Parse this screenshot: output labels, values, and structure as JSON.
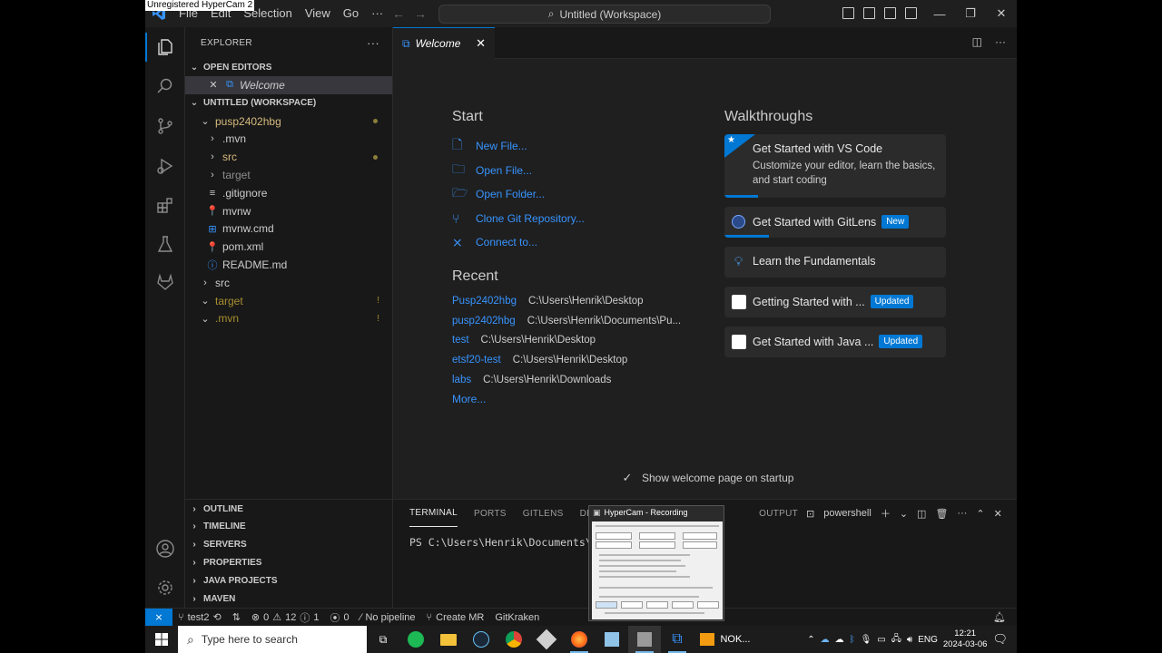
{
  "recorder_label": "Unregistered HyperCam 2",
  "menu": [
    "File",
    "Edit",
    "Selection",
    "View",
    "Go",
    "···"
  ],
  "command_center": "Untitled (Workspace)",
  "explorer": {
    "title": "EXPLORER",
    "open_editors": "OPEN EDITORS",
    "open_file": "Welcome",
    "workspace": "UNTITLED (WORKSPACE)",
    "tree": [
      {
        "label": "pusp2402hbg",
        "indent": 1,
        "chev": "⌄",
        "color": "#d7ba7d",
        "mark": "dot"
      },
      {
        "label": ".mvn",
        "indent": 2,
        "chev": "›",
        "color": "#cccccc",
        "mark": ""
      },
      {
        "label": "src",
        "indent": 2,
        "chev": "›",
        "color": "#d7ba7d",
        "mark": "dot"
      },
      {
        "label": "target",
        "indent": 2,
        "chev": "›",
        "color": "#8c8c8c",
        "mark": ""
      },
      {
        "label": ".gitignore",
        "indent": 2,
        "chev": "",
        "icon": "≡",
        "iconColor": "#cccccc",
        "color": "#cccccc",
        "mark": ""
      },
      {
        "label": "mvnw",
        "indent": 2,
        "chev": "",
        "icon": "📍",
        "iconColor": "#e44",
        "color": "#cccccc",
        "mark": ""
      },
      {
        "label": "mvnw.cmd",
        "indent": 2,
        "chev": "",
        "icon": "⊞",
        "iconColor": "#3794ff",
        "color": "#cccccc",
        "mark": ""
      },
      {
        "label": "pom.xml",
        "indent": 2,
        "chev": "",
        "icon": "📍",
        "iconColor": "#e44",
        "color": "#cccccc",
        "mark": ""
      },
      {
        "label": "README.md",
        "indent": 2,
        "chev": "",
        "icon": "ⓘ",
        "iconColor": "#3794ff",
        "color": "#cccccc",
        "mark": ""
      },
      {
        "label": "src",
        "indent": 1,
        "chev": "›",
        "color": "#cccccc",
        "mark": ""
      },
      {
        "label": "target",
        "indent": 1,
        "chev": "⌄",
        "color": "#a88f2f",
        "mark": "bang"
      },
      {
        "label": ".mvn",
        "indent": 1,
        "chev": "⌄",
        "color": "#a88f2f",
        "mark": "bang"
      }
    ],
    "bottom_sections": [
      "OUTLINE",
      "TIMELINE",
      "SERVERS",
      "PROPERTIES",
      "JAVA PROJECTS",
      "MAVEN"
    ]
  },
  "editor": {
    "tab_label": "Welcome",
    "start_title": "Start",
    "start_items": [
      {
        "label": "New File...",
        "icon": "new-file-icon",
        "glyph": "🗋"
      },
      {
        "label": "Open File...",
        "icon": "open-file-icon",
        "glyph": "🗀"
      },
      {
        "label": "Open Folder...",
        "icon": "open-folder-icon",
        "glyph": "🗁"
      },
      {
        "label": "Clone Git Repository...",
        "icon": "git-branch-icon",
        "glyph": "⑂"
      },
      {
        "label": "Connect to...",
        "icon": "remote-icon",
        "glyph": "⨯"
      }
    ],
    "recent_title": "Recent",
    "recent": [
      {
        "name": "Pusp2402hbg",
        "path": "C:\\Users\\Henrik\\Desktop"
      },
      {
        "name": "pusp2402hbg",
        "path": "C:\\Users\\Henrik\\Documents\\Pu..."
      },
      {
        "name": "test",
        "path": "C:\\Users\\Henrik\\Desktop"
      },
      {
        "name": "etsf20-test",
        "path": "C:\\Users\\Henrik\\Desktop"
      },
      {
        "name": "labs",
        "path": "C:\\Users\\Henrik\\Downloads"
      }
    ],
    "more_label": "More...",
    "walkthroughs_title": "Walkthroughs",
    "walkthroughs": [
      {
        "title": "Get Started with VS Code",
        "desc": "Customize your editor, learn the basics, and start coding",
        "badge": "",
        "progress": 0.15,
        "icon": "star-icon",
        "big": true
      },
      {
        "title": "Get Started with GitLens",
        "desc": "",
        "badge": "New",
        "progress": 0.2,
        "icon": "gitlens-icon",
        "big": false
      },
      {
        "title": "Learn the Fundamentals",
        "desc": "",
        "badge": "",
        "progress": 0.0,
        "icon": "lightbulb-icon",
        "big": false
      },
      {
        "title": "Getting Started with ...",
        "desc": "",
        "badge": "Updated",
        "progress": 0.0,
        "icon": "spring-icon",
        "big": false
      },
      {
        "title": "Get Started with Java ...",
        "desc": "",
        "badge": "Updated",
        "progress": 0.0,
        "icon": "java-icon",
        "big": false
      }
    ],
    "show_welcome": "Show welcome page on startup"
  },
  "panel": {
    "tabs": [
      "TERMINAL",
      "PORTS",
      "GITLENS",
      "DEB",
      "OUTPUT"
    ],
    "shell": "powershell",
    "terminal_text": "PS C:\\Users\\Henrik\\Documents\\"
  },
  "hypercam_popup": {
    "title": "HyperCam - Recording"
  },
  "statusbar": {
    "branch": "test2",
    "errors": "0",
    "warnings": "12",
    "info": "1",
    "ports": "0",
    "pipeline": "No pipeline",
    "create_mr": "Create MR",
    "gitkraken": "GitKraken"
  },
  "taskbar": {
    "search_placeholder": "Type here to search",
    "nok_label": "NOK...",
    "lang": "ENG",
    "time": "12:21",
    "date": "2024-03-06"
  },
  "colors": {
    "accent": "#0078d4",
    "link": "#3794ff",
    "folder_modified": "#d7ba7d"
  }
}
